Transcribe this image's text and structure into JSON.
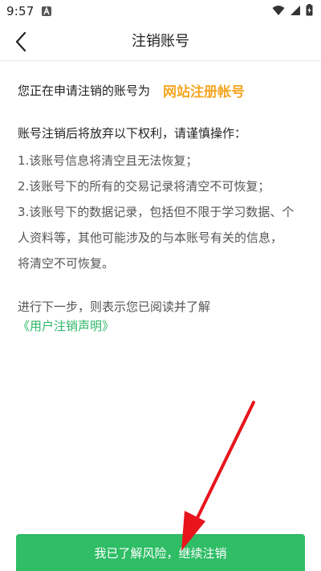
{
  "status_bar": {
    "time": "9:57",
    "icons": [
      "notification-a-icon",
      "wifi-icon",
      "signal-icon",
      "battery-charging-icon"
    ]
  },
  "header": {
    "back_icon": "chevron-left-icon",
    "title": "注销账号"
  },
  "account": {
    "prefix": "您正在申请注销的账号为",
    "name": "网站注册帐号",
    "name_color": "#f5a623"
  },
  "rights": {
    "heading": "账号注销后将放弃以下权利，请谨慎操作：",
    "items": [
      "1.该账号信息将清空且无法恢复；",
      "2.该账号下的所有的交易记录将清空不可恢复；",
      "3.该账号下的数据记录，包括但不限于学习数据、个",
      "人资料等，其他可能涉及的与本账号有关的信息，",
      "将清空不可恢复。"
    ]
  },
  "notice": {
    "text": "进行下一步，则表示您已阅读并了解",
    "link_label": "《用户注销声明》",
    "link_color": "#2db666"
  },
  "confirm_button": {
    "label": "我已了解风险，继续注销",
    "color": "#2fbd66"
  },
  "annotation": {
    "arrow_color": "#e8141c"
  }
}
